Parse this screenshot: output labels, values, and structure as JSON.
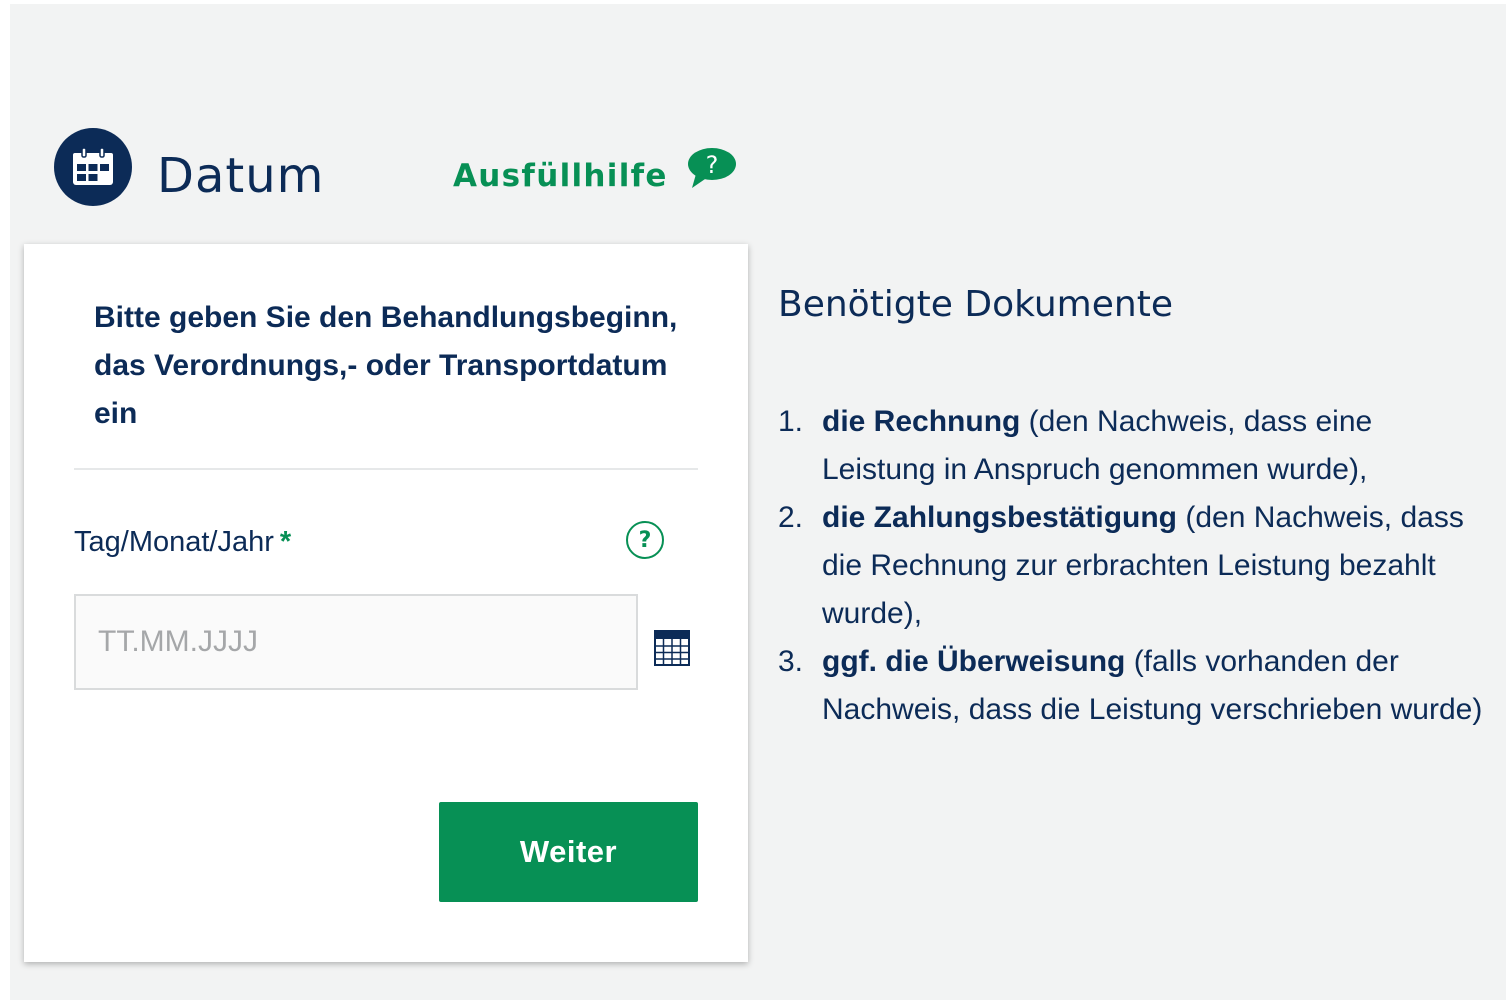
{
  "header": {
    "title": "Datum",
    "title_icon": "calendar-icon",
    "help_link_label": "Ausfüllhilfe",
    "help_link_icon": "question-bubble-icon"
  },
  "form": {
    "instruction": "Bitte geben Sie den Behandlungsbeginn, das Verordnungs,- oder Transportdatum ein",
    "date_field": {
      "label": "Tag/Monat/Jahr",
      "required_mark": "*",
      "help_icon_text": "?",
      "placeholder": "TT.MM.JJJJ",
      "value": "",
      "picker_icon": "calendar-grid-icon"
    },
    "submit_label": "Weiter"
  },
  "documents": {
    "title": "Benötigte Dokumente",
    "items": [
      {
        "number": "1.",
        "strong": "die Rechnung",
        "rest": " (den Nachweis, dass eine Leistung in Anspruch genommen wurde),"
      },
      {
        "number": "2.",
        "strong": "die Zahlungsbestätigung",
        "rest": " (den Nachweis, dass die Rechnung zur erbrachten Leistung bezahlt wurde),"
      },
      {
        "number": "3.",
        "strong": "ggf. die Überweisung",
        "rest": " (falls vorhanden der Nachweis, dass die Leistung verschrieben wurde)"
      }
    ]
  },
  "colors": {
    "navy": "#0c2b57",
    "green": "#079055",
    "background": "#f2f3f3"
  }
}
